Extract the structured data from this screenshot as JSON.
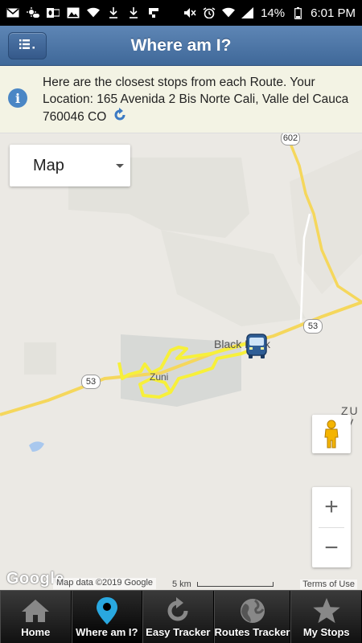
{
  "status_bar": {
    "left_icons": [
      "gmail-icon",
      "weather-icon",
      "outlook-icon",
      "gallery-icon",
      "wifi-icon",
      "download-icon",
      "download-icon",
      "flipboard-icon"
    ],
    "right_icons": [
      "mute-icon",
      "alarm-icon",
      "wifi-icon",
      "signal-icon"
    ],
    "battery": "14%",
    "time": "6:01 PM"
  },
  "header": {
    "title": "Where am I?",
    "menu_icon": "list-icon"
  },
  "info": {
    "text": "Here are the closest stops from each Route. Your Location: 165 Avenida 2 Bis Norte Cali, Valle del Cauca 760046 CO",
    "icon": "info-icon",
    "refresh_icon": "refresh-icon"
  },
  "map": {
    "type_selector": "Map",
    "labels": {
      "town_1": "Black Rock",
      "town_2": "Zuni",
      "town_3_a": "ZU",
      "town_3_b": "R V"
    },
    "shields": {
      "r602": "602",
      "r53_east": "53",
      "r53_west": "53"
    },
    "zoom_in": "+",
    "zoom_out": "−",
    "google": "Google",
    "attribution": "Map data ©2019 Google",
    "scale_label": "5 km",
    "terms": "Terms of Use",
    "colors": {
      "route": "#f7f03a",
      "highway": "#f5d75c",
      "map_bg": "#ebe9e4"
    }
  },
  "nav": {
    "items": [
      {
        "label": "Home",
        "icon": "home-icon"
      },
      {
        "label": "Where am I?",
        "icon": "location-pin-icon"
      },
      {
        "label": "Easy Tracker",
        "icon": "refresh-icon"
      },
      {
        "label": "Routes Tracker",
        "icon": "globe-icon"
      },
      {
        "label": "My Stops",
        "icon": "star-icon"
      }
    ],
    "active_index": 1
  }
}
